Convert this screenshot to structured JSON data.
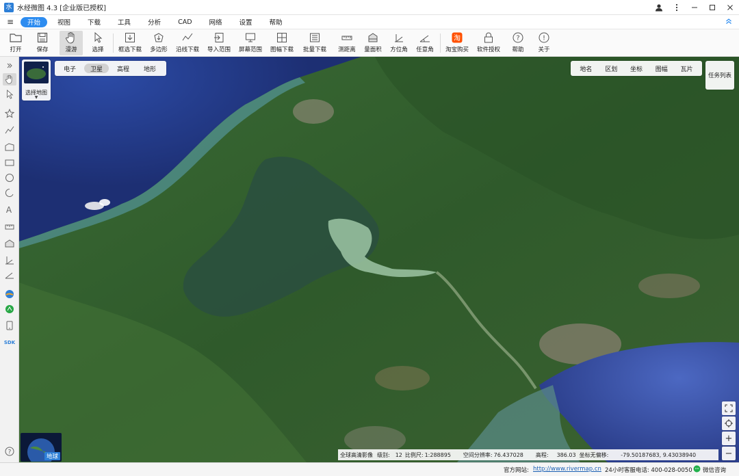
{
  "app": {
    "title": "水经微图 4.3 [企业版已授权]",
    "logo_glyph": "水"
  },
  "menu": [
    {
      "label": "开始",
      "active": true
    },
    {
      "label": "视图"
    },
    {
      "label": "下载"
    },
    {
      "label": "工具"
    },
    {
      "label": "分析"
    },
    {
      "label": "CAD"
    },
    {
      "label": "网络"
    },
    {
      "label": "设置"
    },
    {
      "label": "帮助"
    }
  ],
  "ribbon": [
    {
      "label": "打开",
      "icon": "folder-icon"
    },
    {
      "label": "保存",
      "icon": "save-icon"
    },
    {
      "label": "漫游",
      "icon": "hand-icon",
      "active": true
    },
    {
      "label": "选择",
      "icon": "pointer-icon"
    },
    {
      "label": "框选下载",
      "icon": "rect-download-icon"
    },
    {
      "label": "多边形",
      "icon": "polygon-download-icon"
    },
    {
      "label": "沿线下载",
      "icon": "line-download-icon"
    },
    {
      "label": "导入范围",
      "icon": "import-range-icon"
    },
    {
      "label": "屏幕范围",
      "icon": "screen-range-icon"
    },
    {
      "label": "图幅下载",
      "icon": "sheet-download-icon"
    },
    {
      "label": "批量下载",
      "icon": "batch-download-icon"
    },
    {
      "label": "测距离",
      "icon": "measure-distance-icon"
    },
    {
      "label": "量面积",
      "icon": "measure-area-icon"
    },
    {
      "label": "方位角",
      "icon": "azimuth-icon"
    },
    {
      "label": "任意角",
      "icon": "angle-icon"
    },
    {
      "label": "淘宝购买",
      "icon": "taobao-icon"
    },
    {
      "label": "软件授权",
      "icon": "lock-icon"
    },
    {
      "label": "帮助",
      "icon": "help-icon"
    },
    {
      "label": "关于",
      "icon": "info-icon"
    }
  ],
  "mapselect": {
    "label": "选择地图"
  },
  "map_types": [
    {
      "label": "电子"
    },
    {
      "label": "卫星",
      "active": true
    },
    {
      "label": "高程"
    },
    {
      "label": "地形"
    }
  ],
  "layer_tools": [
    {
      "label": "地名"
    },
    {
      "label": "区划"
    },
    {
      "label": "坐标"
    },
    {
      "label": "图幅"
    },
    {
      "label": "瓦片"
    }
  ],
  "task_list": "任务列表",
  "globe_label": "地球",
  "info": {
    "source": "全球高清影像",
    "level_label": "级别:",
    "level": "12",
    "scale_label": "比例尺:",
    "scale": "1:288895",
    "resolution_label": "空间分辨率:",
    "resolution": "76.437028",
    "elev_label": "高程:",
    "elevation": "386.03",
    "coord_label": "坐标无偏移:",
    "coords": "-79.50187683, 9.43038940"
  },
  "status": {
    "site_label": "官方网站:",
    "site_url": "http://www.rivermap.cn",
    "phone": "24小时客服电话: 400-028-0050",
    "wechat": "微信咨询"
  },
  "colors": {
    "accent": "#2d8cf0",
    "ocean": "#2f4a9c",
    "forest": "#355f2c"
  }
}
